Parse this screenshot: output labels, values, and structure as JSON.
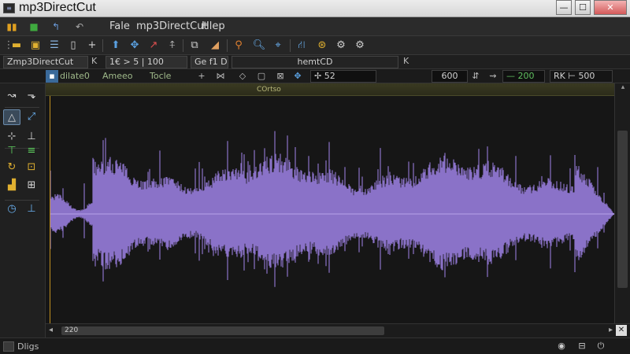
{
  "window": {
    "app_icon": "mp3directcut-app-icon",
    "title": "mp3DirectCut",
    "controls": {
      "minimize": "—",
      "maximize": "☐",
      "close": "✕"
    }
  },
  "menubar": {
    "icons": [
      "mdi-icon",
      "folder-icon",
      "undo-icon"
    ],
    "items": [
      "Fale",
      "mp3DirectCut",
      "Hlep"
    ]
  },
  "toolbar": {
    "icons": [
      "open-folder-icon",
      "save-icon",
      "list-icon",
      "split-icon",
      "plus-icon",
      "cut-icon",
      "crosshair-icon",
      "pen-icon",
      "normalize-icon",
      "crop-icon",
      "fade-icon",
      "search-icon",
      "zoom-icon",
      "locate-icon",
      "network-icon",
      "target-icon",
      "gear-icon",
      "settings-icon"
    ]
  },
  "docbar": {
    "tab1": "Zmp3DirectCut",
    "tab1_close": "K",
    "tab2": "1€ > 5 | 100",
    "tab3": "Ge f1 D",
    "tab4": "hemtCD",
    "tab4_close": "K"
  },
  "modebar": {
    "tabs": [
      "dilate0",
      "Ameeo",
      "Tocle"
    ],
    "position_value": "52",
    "start_value": "600",
    "mid_value": "200",
    "end_label": "RK",
    "end_value": "500"
  },
  "lefttools": {
    "icons": [
      "curve-icon",
      "fade-right-icon",
      "triangle-select-icon",
      "fade-in-icon",
      "split-plus-icon",
      "cue-icon",
      "marker-left-icon",
      "marker-right-icon",
      "loop-icon",
      "lock-icon",
      "layers-icon",
      "grid-icon",
      "clock-icon",
      "download-icon"
    ]
  },
  "waveform": {
    "ruler_label": "COrtso",
    "wave_color": "#8a72c8",
    "cursor_color": "#c09020",
    "ruler_color": "#3a3a22"
  },
  "hscroll": {
    "left_label": "◂",
    "thumb_label": "220",
    "right_label": "▸",
    "close_label": "✕"
  },
  "statusbar": {
    "text": "Dligs"
  }
}
